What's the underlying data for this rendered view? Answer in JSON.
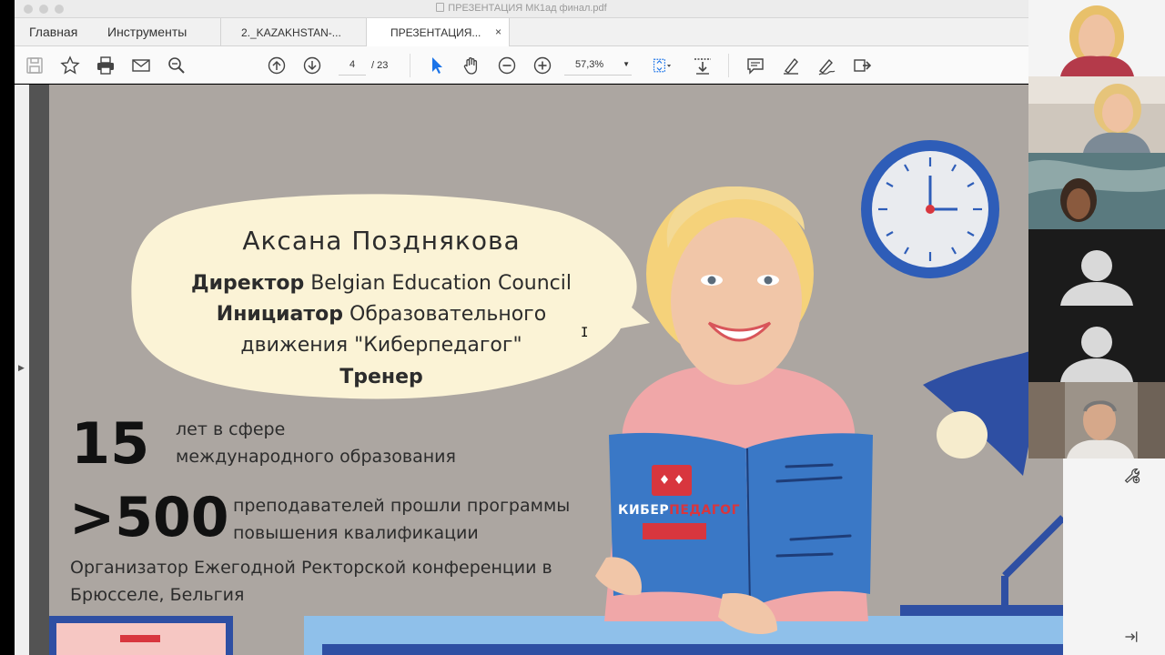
{
  "window": {
    "title": "ПРЕЗЕНТАЦИЯ МК1ад финал.pdf"
  },
  "menu": {
    "home": "Главная",
    "tools": "Инструменты"
  },
  "tabs": [
    {
      "label": "2._KAZAKHSTAN-..."
    },
    {
      "label": "ПРЕЗЕНТАЦИЯ...",
      "close": "×"
    }
  ],
  "toolbar": {
    "page_current": "4",
    "page_total": "/ 23",
    "zoom": "57,3%"
  },
  "slide": {
    "name": "Аксана Позднякова",
    "role1_bold": "Директор",
    "role1_rest": " Belgian Education Council",
    "role2_bold": "Инициатор",
    "role2_rest": " Образовательного",
    "role2_line2": "движения \"Киберпедагог\"",
    "role3_bold": "Тренер",
    "stat1_num": "15",
    "stat1_line1": "лет в сфере",
    "stat1_line2": "международного образования",
    "stat2_num": ">500",
    "stat2_line1": "преподавателей прошли программы",
    "stat2_line2": "повышения квалификации",
    "org_line1": "Организатор Ежегодной Ректорской конференции в",
    "org_line2": "Брюсселе, Бельгия",
    "book_logo_a": "КИБЕР",
    "book_logo_b": "ПЕДАГОГ"
  },
  "colors": {
    "slide_bg": "#aca6a1",
    "bubble": "#fbf3d6",
    "clock_blue": "#2e5db8",
    "book_blue": "#3a78c6",
    "shirt_pink": "#f0a7a8",
    "logo_red": "#d8363e"
  },
  "video_tiles": [
    {
      "kind": "camera"
    },
    {
      "kind": "camera"
    },
    {
      "kind": "camera"
    },
    {
      "kind": "placeholder"
    },
    {
      "kind": "placeholder"
    },
    {
      "kind": "camera"
    }
  ]
}
